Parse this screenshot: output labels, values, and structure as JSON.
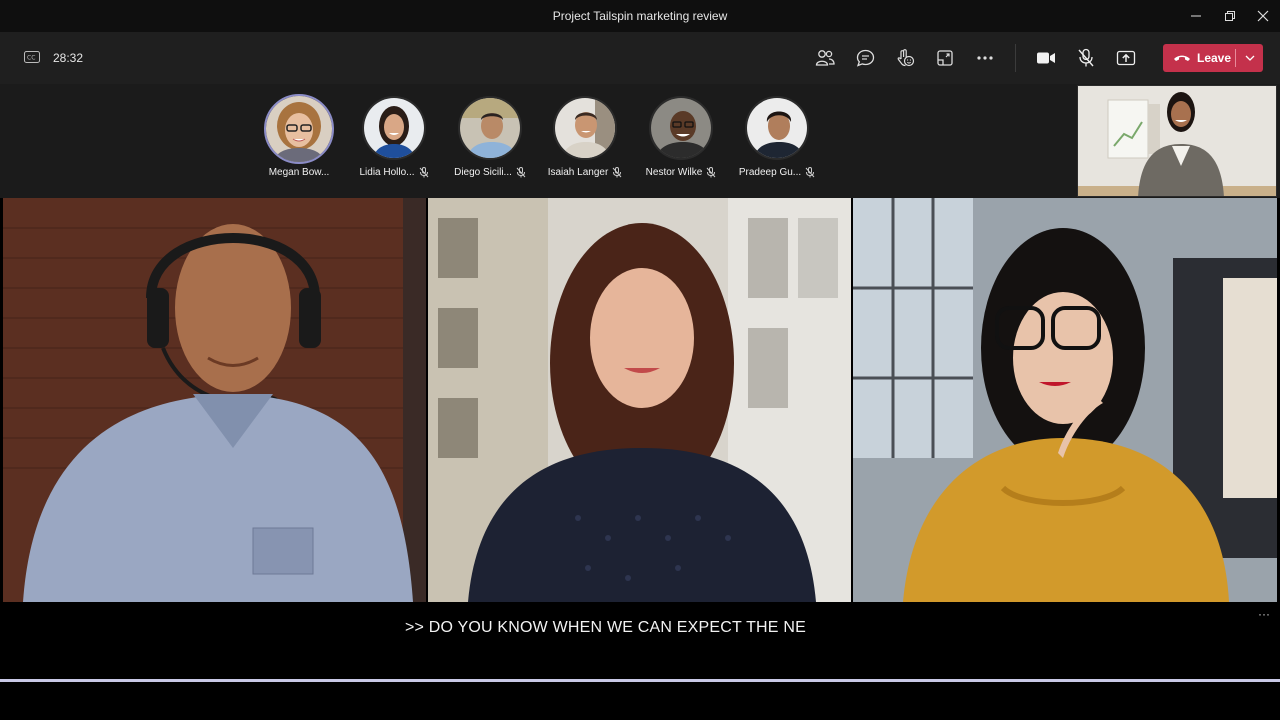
{
  "window": {
    "title": "Project Tailspin marketing review",
    "controls": [
      "minimize-icon",
      "restore-icon",
      "close-icon"
    ]
  },
  "toolbar": {
    "captions_icon": "closed-captions-icon",
    "elapsed_time": "28:32",
    "buttons": [
      "participants-icon",
      "chat-icon",
      "reactions-icon",
      "rooms-icon",
      "more-icon",
      "camera-icon",
      "mic-muted-icon",
      "share-icon"
    ],
    "leave_label": "Leave",
    "leave_color": "#c4314b"
  },
  "participants": [
    {
      "name": "Megan Bow...",
      "active": true,
      "muted": false
    },
    {
      "name": "Lidia Hollo...",
      "active": false,
      "muted": true
    },
    {
      "name": "Diego Sicili...",
      "active": false,
      "muted": true
    },
    {
      "name": "Isaiah Langer",
      "active": false,
      "muted": true
    },
    {
      "name": "Nestor Wilke",
      "active": false,
      "muted": true
    },
    {
      "name": "Pradeep Gu...",
      "active": false,
      "muted": true
    }
  ],
  "captions": {
    "text": ">> DO YOU KNOW WHEN WE CAN EXPECT THE NE",
    "more": "···"
  },
  "colors": {
    "active_speaker_ring": "#8b8cc7",
    "toolbar_bg": "#1f1f1f"
  }
}
